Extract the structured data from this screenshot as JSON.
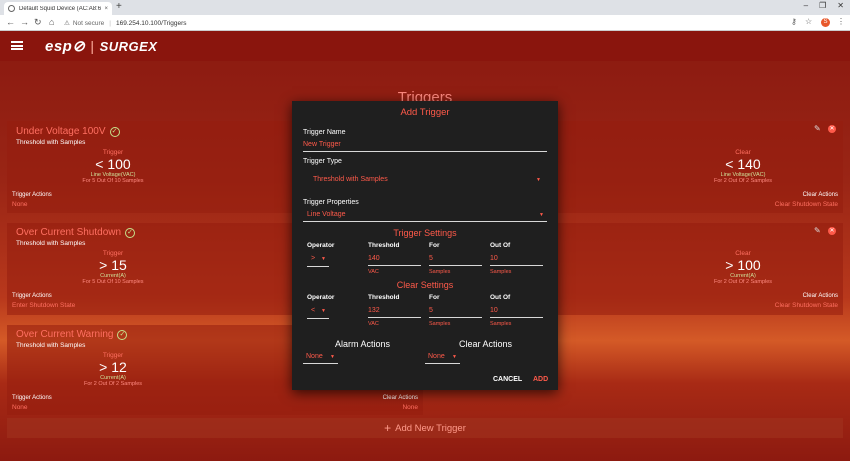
{
  "browser": {
    "tab_title": "Default Squid Device (AC:A8:67:D",
    "url_warning": "Not secure",
    "url": "169.254.10.100/Triggers",
    "profile_initial": "S"
  },
  "page": {
    "title": "Triggers"
  },
  "cards": [
    {
      "title": "Under Voltage 100V",
      "subtitle": "Threshold with Samples",
      "trigger": {
        "label": "Trigger",
        "value": "< 100",
        "unit": "Line Voltage(VAC)",
        "count": "For 5 Out Of 10 Samples"
      },
      "clear": {
        "label": "Clear",
        "value": "< 140",
        "unit": "Line Voltage(VAC)",
        "count": "For 2 Out Of 2 Samples"
      },
      "trigger_actions_label": "Trigger Actions",
      "trigger_actions": "None",
      "clear_actions_label": "Clear Actions",
      "clear_actions": "Clear Shutdown State"
    },
    {
      "title": "Over Current Shutdown",
      "subtitle": "Threshold with Samples",
      "trigger": {
        "label": "Trigger",
        "value": "> 15",
        "unit": "Current(A)",
        "count": "For 5 Out Of 10 Samples"
      },
      "clear": {
        "label": "Clear",
        "value": "> 100",
        "unit": "Current(A)",
        "count": "For 2 Out Of 2 Samples"
      },
      "trigger_actions_label": "Trigger Actions",
      "trigger_actions": "Enter Shutdown State",
      "clear_actions_label": "Clear Actions",
      "clear_actions": "Clear Shutdown State"
    },
    {
      "title": "Over Current Warning",
      "subtitle": "Threshold with Samples",
      "trigger": {
        "label": "Trigger",
        "value": "> 12",
        "unit": "Current(A)",
        "count": "For 2 Out Of 2 Samples"
      },
      "trigger_actions_label": "Trigger Actions",
      "trigger_actions": "None",
      "clear_actions_label": "Clear Actions",
      "clear_actions": "None"
    }
  ],
  "add_button": "Add New Trigger",
  "modal": {
    "title": "Add Trigger",
    "name_label": "Trigger Name",
    "name_value": "New Trigger",
    "type_label": "Trigger Type",
    "type_value": "Threshold with Samples",
    "props_label": "Trigger Properties",
    "props_value": "Line Voltage",
    "trigger_settings": {
      "heading": "Trigger Settings",
      "operator_label": "Operator",
      "operator": ">",
      "threshold_label": "Threshold",
      "threshold": "140",
      "threshold_hint": "VAC",
      "for_label": "For",
      "for": "5",
      "for_hint": "Samples",
      "outof_label": "Out Of",
      "outof": "10",
      "outof_hint": "Samples"
    },
    "clear_settings": {
      "heading": "Clear Settings",
      "operator_label": "Operator",
      "operator": "<",
      "threshold_label": "Threshold",
      "threshold": "132",
      "threshold_hint": "VAC",
      "for_label": "For",
      "for": "5",
      "for_hint": "Samples",
      "outof_label": "Out Of",
      "outof": "10",
      "outof_hint": "Samples"
    },
    "alarm_actions_label": "Alarm Actions",
    "alarm_actions": "None",
    "clear_actions_label": "Clear Actions",
    "clear_actions": "None",
    "cancel": "CANCEL",
    "add": "ADD"
  },
  "colors": {
    "accent": "#ff5a4a",
    "header": "#8a150d",
    "modal_bg": "#1f1f1f"
  }
}
